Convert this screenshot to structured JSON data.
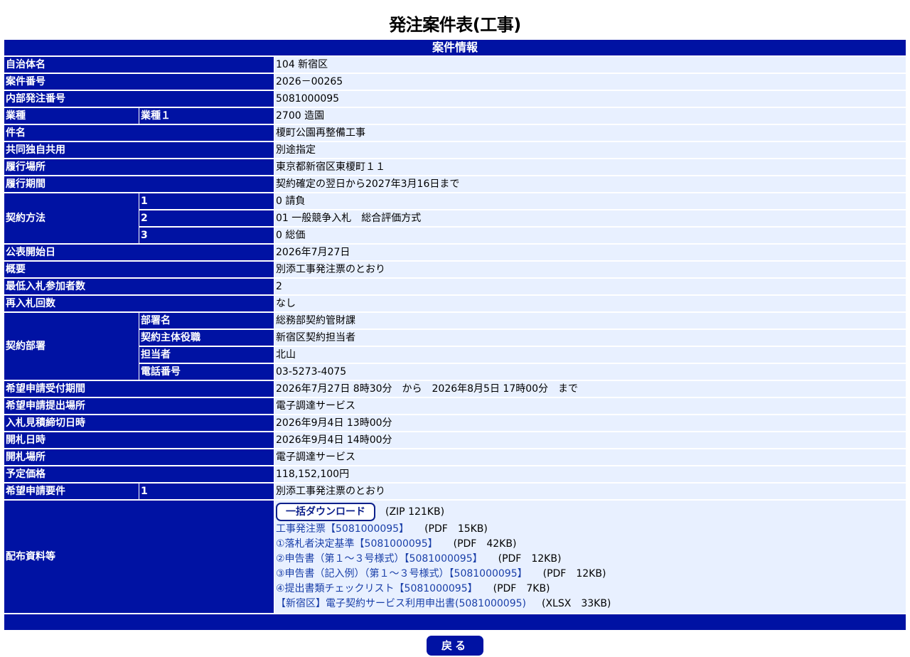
{
  "page": {
    "title": "発注案件表(工事)",
    "section_header": "案件情報",
    "back_label": "戻る"
  },
  "fields": {
    "municipality": {
      "label": "自治体名",
      "value": "104 新宿区"
    },
    "case_no": {
      "label": "案件番号",
      "value": "2026－00265"
    },
    "internal_no": {
      "label": "内部発注番号",
      "value": "5081000095"
    },
    "industry": {
      "label": "業種",
      "sublabel": "業種１",
      "value": "2700 造園"
    },
    "subject": {
      "label": "件名",
      "value": "榎町公園再整備工事"
    },
    "joint": {
      "label": "共同独自共用",
      "value": "別途指定"
    },
    "location": {
      "label": "履行場所",
      "value": "東京都新宿区東榎町１１"
    },
    "period": {
      "label": "履行期間",
      "value": "契約確定の翌日から2027年3月16日まで"
    },
    "contract_method": {
      "label": "契約方法",
      "rows": [
        {
          "no": "1",
          "value": "0 請負"
        },
        {
          "no": "2",
          "value": "01 一般競争入札　総合評価方式"
        },
        {
          "no": "3",
          "value": "0 総価"
        }
      ]
    },
    "publish_date": {
      "label": "公表開始日",
      "value": "2026年7月27日"
    },
    "summary": {
      "label": "概要",
      "value": "別添工事発注票のとおり"
    },
    "min_bidders": {
      "label": "最低入札参加者数",
      "value": "2"
    },
    "rebid": {
      "label": "再入札回数",
      "value": "なし"
    },
    "department": {
      "label": "契約部署",
      "rows": [
        {
          "sublabel": "部署名",
          "value": "総務部契約管財課"
        },
        {
          "sublabel": "契約主体役職",
          "value": "新宿区契約担当者"
        },
        {
          "sublabel": "担当者",
          "value": "北山"
        },
        {
          "sublabel": "電話番号",
          "value": "03-5273-4075"
        }
      ]
    },
    "application_period": {
      "label": "希望申請受付期間",
      "value": "2026年7月27日 8時30分　から　2026年8月5日 17時00分　まで"
    },
    "application_place": {
      "label": "希望申請提出場所",
      "value": "電子調達サービス"
    },
    "bid_deadline": {
      "label": "入札見積締切日時",
      "value": "2026年9月4日 13時00分"
    },
    "opening_date": {
      "label": "開札日時",
      "value": "2026年9月4日 14時00分"
    },
    "opening_place": {
      "label": "開札場所",
      "value": "電子調達サービス"
    },
    "planned_price": {
      "label": "予定価格",
      "value": "118,152,100円"
    },
    "requirements": {
      "label": "希望申請要件",
      "no": "1",
      "value": "別添工事発注票のとおり"
    }
  },
  "documents": {
    "label": "配布資料等",
    "bulk_label": "一括ダウンロード",
    "bulk_info": "(ZIP 121KB)",
    "files": [
      {
        "name": "工事発注票【5081000095】",
        "info": "(PDF　15KB)"
      },
      {
        "name": "①落札者決定基準【5081000095】",
        "info": "(PDF　42KB)"
      },
      {
        "name": "②申告書（第１～３号様式）【5081000095】",
        "info": "(PDF　12KB)"
      },
      {
        "name": "③申告書（記入例）（第１～３号様式）【5081000095】",
        "info": "(PDF　12KB)"
      },
      {
        "name": "④提出書類チェックリスト【5081000095】",
        "info": "(PDF　7KB)"
      },
      {
        "name": "【新宿区】電子契約サービス利用申出書(5081000095)",
        "info": "(XLSX　33KB)"
      }
    ]
  },
  "colors": {
    "header_bg": "#0012a3",
    "value_bg": "#e8f0ff",
    "link": "#1a3fa8"
  }
}
